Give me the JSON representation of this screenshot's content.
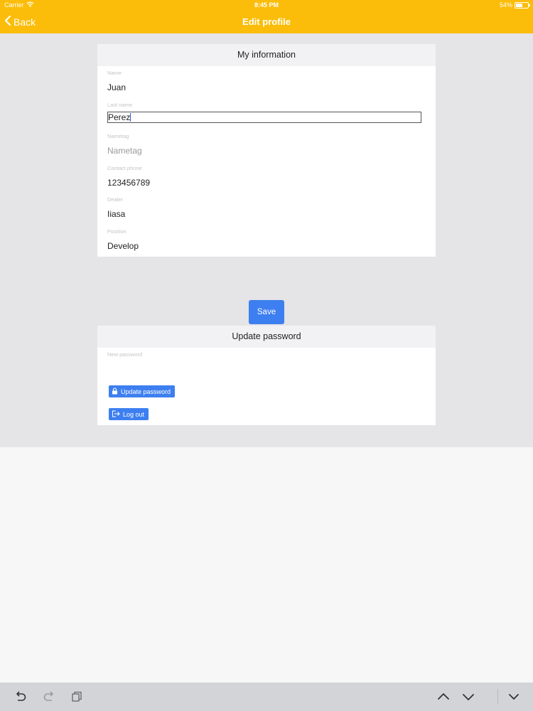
{
  "status_bar": {
    "carrier": "Carrier",
    "time": "8:45 PM",
    "battery": "54%",
    "battery_level": 0.54
  },
  "nav": {
    "back_label": "Back",
    "title": "Edit profile"
  },
  "my_information": {
    "header": "My information",
    "fields": [
      {
        "label": "Name",
        "value": "Juan"
      },
      {
        "label": "Last name",
        "value": "Perez"
      },
      {
        "label": "Nametag",
        "placeholder": "Nametag"
      },
      {
        "label": "Contact phone",
        "value": "123456789"
      },
      {
        "label": "Dealer",
        "value": "Iiasa"
      },
      {
        "label": "Position",
        "value": "Develop"
      }
    ]
  },
  "save_label": "Save",
  "update_password": {
    "header": "Update password",
    "new_password_label": "New password",
    "update_button_label": "Update password",
    "logout_button_label": "Log out"
  },
  "icons": {
    "back": "chevron-left-icon",
    "wifi": "wifi-icon",
    "battery": "battery-icon",
    "lock": "lock-icon",
    "logout": "logout-icon",
    "undo": "undo-icon",
    "redo": "redo-icon",
    "paste": "clipboard-icon",
    "previous": "chevron-up-icon",
    "next": "chevron-down-icon",
    "dismiss": "keyboard-dismiss-icon"
  },
  "colors": {
    "accent": "#fbbd09",
    "button": "#3d7ff0",
    "background": "#e5e4e6"
  }
}
